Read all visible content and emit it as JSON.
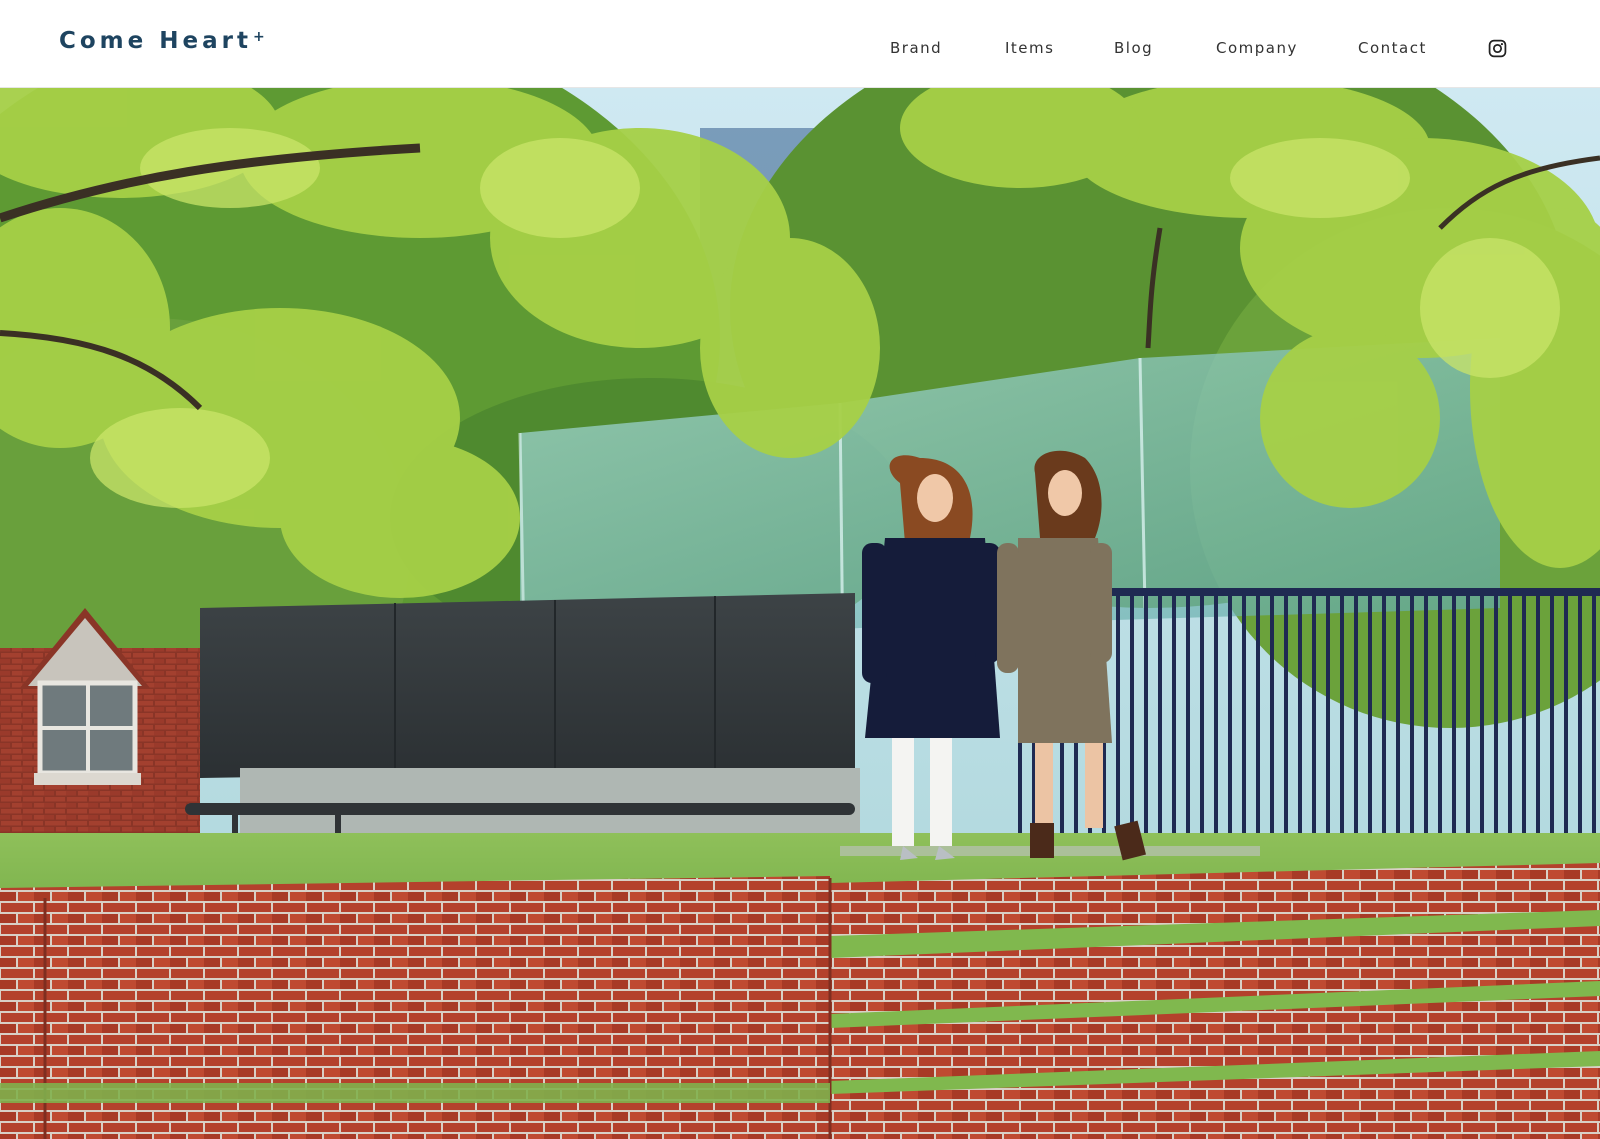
{
  "header": {
    "logo": {
      "text": "Come Heart",
      "superscript": "+"
    },
    "nav": [
      {
        "label": "Brand"
      },
      {
        "label": "Items"
      },
      {
        "label": "Blog"
      },
      {
        "label": "Company"
      },
      {
        "label": "Contact"
      }
    ],
    "social_icon": "instagram-icon"
  },
  "hero": {
    "image": "hero-photo",
    "subject": "two women standing in a park with trees, glass sculpture, black railings and brick steps"
  },
  "colors": {
    "brand_navy": "#1e4460",
    "nav_text": "#333333",
    "header_bg": "#ffffff"
  }
}
